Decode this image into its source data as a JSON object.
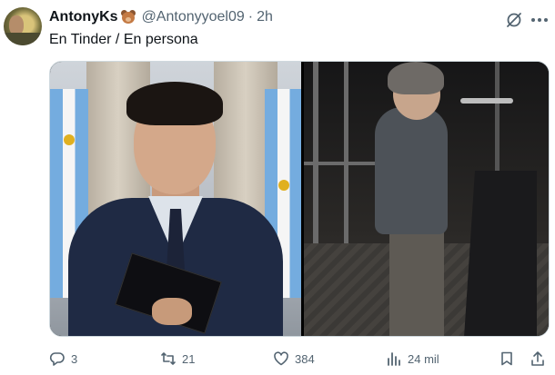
{
  "tweet": {
    "author_name": "AntonyKs",
    "author_emoji": "bear-face-emoji",
    "handle": "@Antonyyoel09",
    "separator": "·",
    "time": "2h",
    "text": "En Tinder / En persona"
  },
  "media": {
    "left_photo": "formal-portrait-photo",
    "right_photo": "stage-podium-photo"
  },
  "actions": {
    "reply_count": "3",
    "retweet_count": "21",
    "like_count": "384",
    "views_count": "24 mil"
  },
  "icons": {
    "grok": "grok-icon",
    "more": "more-icon",
    "reply": "reply-icon",
    "retweet": "retweet-icon",
    "like": "heart-icon",
    "views": "views-icon",
    "bookmark": "bookmark-icon",
    "share": "share-icon"
  },
  "colors": {
    "text_primary": "#0f1419",
    "text_secondary": "#536471",
    "border": "#cfd9de"
  }
}
